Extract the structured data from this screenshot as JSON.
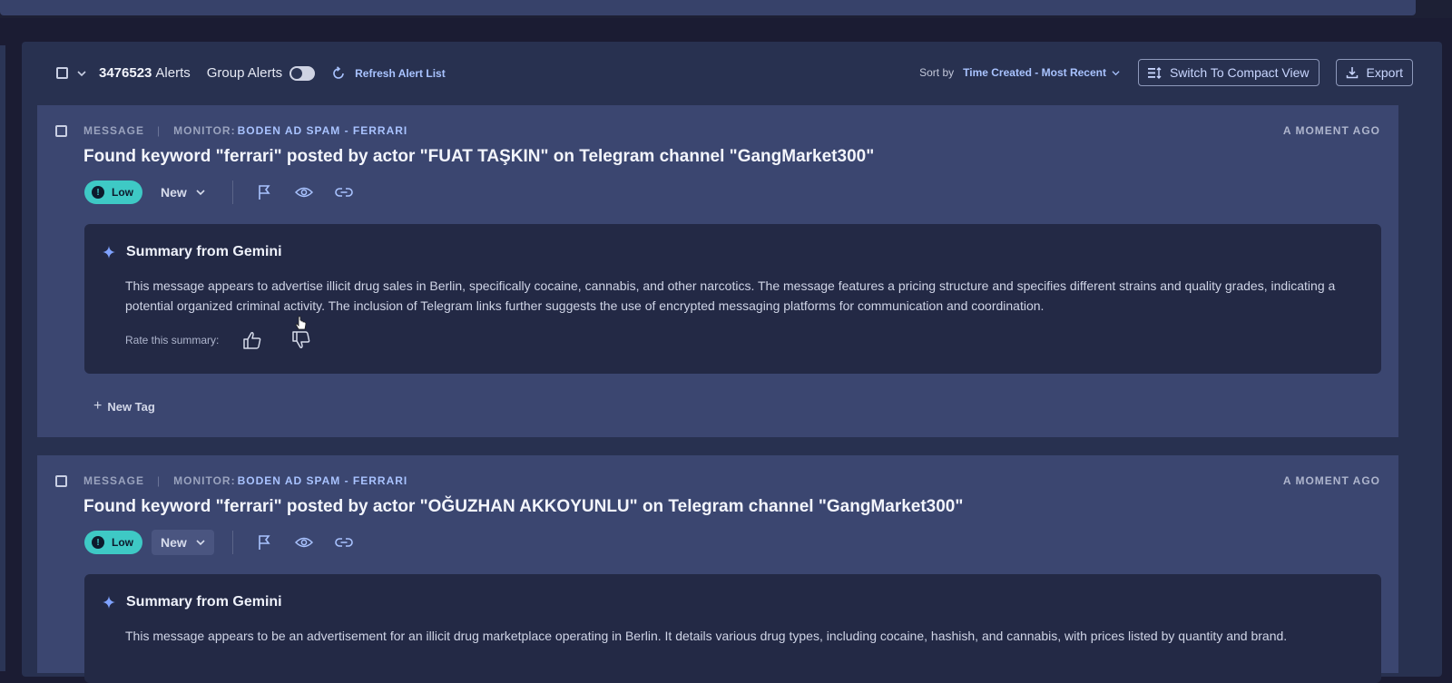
{
  "toolbar": {
    "alert_count": "3476523",
    "alert_count_label": "Alerts",
    "group_alerts_label": "Group Alerts",
    "refresh_label": "Refresh Alert List",
    "sort_by_label": "Sort by",
    "sort_value": "Time Created - Most Recent",
    "compact_view_label": "Switch To Compact View",
    "export_label": "Export"
  },
  "alerts": [
    {
      "type": "MESSAGE",
      "monitor_label": "MONITOR:",
      "monitor_name": "BODEN AD SPAM - FERRARI",
      "time": "A MOMENT AGO",
      "title": "Found keyword \"ferrari\" posted by actor \"FUAT TAŞKIN\" on Telegram channel \"GangMarket300\"",
      "severity": "Low",
      "status": "New",
      "summary_title": "Summary from Gemini",
      "summary_text": "This message appears to advertise illicit drug sales in Berlin, specifically cocaine, cannabis, and other narcotics. The message features a pricing structure and specifies different strains and quality grades, indicating a potential organized criminal activity. The inclusion of Telegram links further suggests the use of encrypted messaging platforms for communication and coordination.",
      "rate_label": "Rate this summary:",
      "new_tag_label": "New Tag"
    },
    {
      "type": "MESSAGE",
      "monitor_label": "MONITOR:",
      "monitor_name": "BODEN AD SPAM - FERRARI",
      "time": "A MOMENT AGO",
      "title": "Found keyword \"ferrari\" posted by actor \"OĞUZHAN AKKOYUNLU\" on Telegram channel \"GangMarket300\"",
      "severity": "Low",
      "status": "New",
      "summary_title": "Summary from Gemini",
      "summary_text": "This message appears to be an advertisement for an illicit drug marketplace operating in Berlin. It details various drug types, including cocaine, hashish, and cannabis, with prices listed by quantity and brand."
    }
  ],
  "colors": {
    "background": "#1b1c33",
    "card": "#3b4670",
    "summary_panel": "#232945",
    "severity_low": "#3ec9c5",
    "link_accent": "#a9c3ff"
  },
  "icons": [
    "chevron-down-icon",
    "refresh-icon",
    "compact-view-icon",
    "download-icon",
    "exclamation-icon",
    "flag-icon",
    "eye-icon",
    "link-icon",
    "sparkle-icon",
    "thumbs-up-icon",
    "thumbs-down-icon",
    "plus-icon",
    "cursor-icon"
  ]
}
